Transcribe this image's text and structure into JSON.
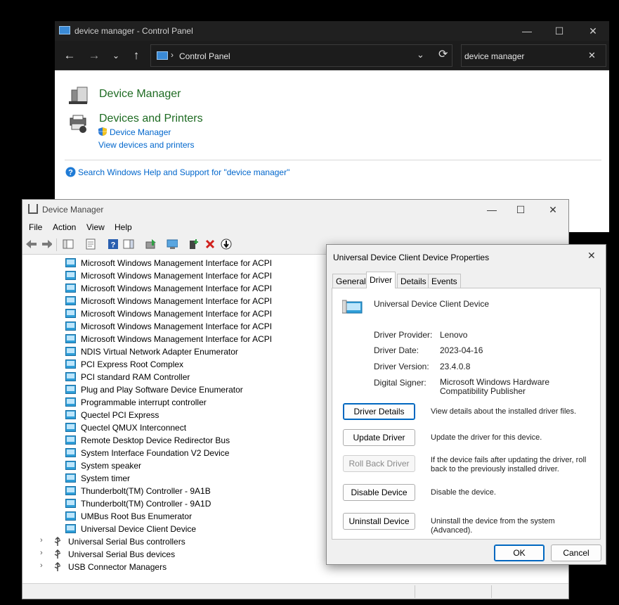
{
  "control_panel": {
    "title": "device manager - Control Panel",
    "breadcrumb": "Control Panel",
    "search_value": "device manager",
    "results": [
      {
        "heading": "Device Manager"
      },
      {
        "heading": "Devices and Printers",
        "links": [
          "Device Manager",
          "View devices and printers"
        ]
      }
    ],
    "help_link": "Search Windows Help and Support for \"device manager\""
  },
  "device_manager": {
    "title": "Device Manager",
    "menu": [
      "File",
      "Action",
      "View",
      "Help"
    ],
    "tree_items": [
      "Microsoft Windows Management Interface for ACPI",
      "Microsoft Windows Management Interface for ACPI",
      "Microsoft Windows Management Interface for ACPI",
      "Microsoft Windows Management Interface for ACPI",
      "Microsoft Windows Management Interface for ACPI",
      "Microsoft Windows Management Interface for ACPI",
      "Microsoft Windows Management Interface for ACPI",
      "NDIS Virtual Network Adapter Enumerator",
      "PCI Express Root Complex",
      "PCI standard RAM Controller",
      "Plug and Play Software Device Enumerator",
      "Programmable interrupt controller",
      "Quectel PCI Express",
      "Quectel QMUX Interconnect",
      "Remote Desktop Device Redirector Bus",
      "System Interface Foundation V2 Device",
      "System speaker",
      "System timer",
      "Thunderbolt(TM) Controller - 9A1B",
      "Thunderbolt(TM) Controller - 9A1D",
      "UMBus Root Bus Enumerator",
      "Universal Device Client Device"
    ],
    "categories": [
      "Universal Serial Bus controllers",
      "Universal Serial Bus devices",
      "USB Connector Managers"
    ]
  },
  "properties": {
    "title": "Universal Device Client Device Properties",
    "tabs": [
      "General",
      "Driver",
      "Details",
      "Events"
    ],
    "active_tab": "Driver",
    "device_name": "Universal Device Client Device",
    "fields": [
      {
        "label": "Driver Provider:",
        "value": "Lenovo"
      },
      {
        "label": "Driver Date:",
        "value": "2023-04-16"
      },
      {
        "label": "Driver Version:",
        "value": "23.4.0.8"
      },
      {
        "label": "Digital Signer:",
        "value": "Microsoft Windows Hardware Compatibility Publisher"
      }
    ],
    "actions": [
      {
        "button": "Driver Details",
        "desc": "View details about the installed driver files."
      },
      {
        "button": "Update Driver",
        "desc": "Update the driver for this device."
      },
      {
        "button": "Roll Back Driver",
        "desc": "If the device fails after updating the driver, roll back to the previously installed driver."
      },
      {
        "button": "Disable Device",
        "desc": "Disable the device."
      },
      {
        "button": "Uninstall Device",
        "desc": "Uninstall the device from the system (Advanced)."
      }
    ],
    "ok": "OK",
    "cancel": "Cancel"
  }
}
